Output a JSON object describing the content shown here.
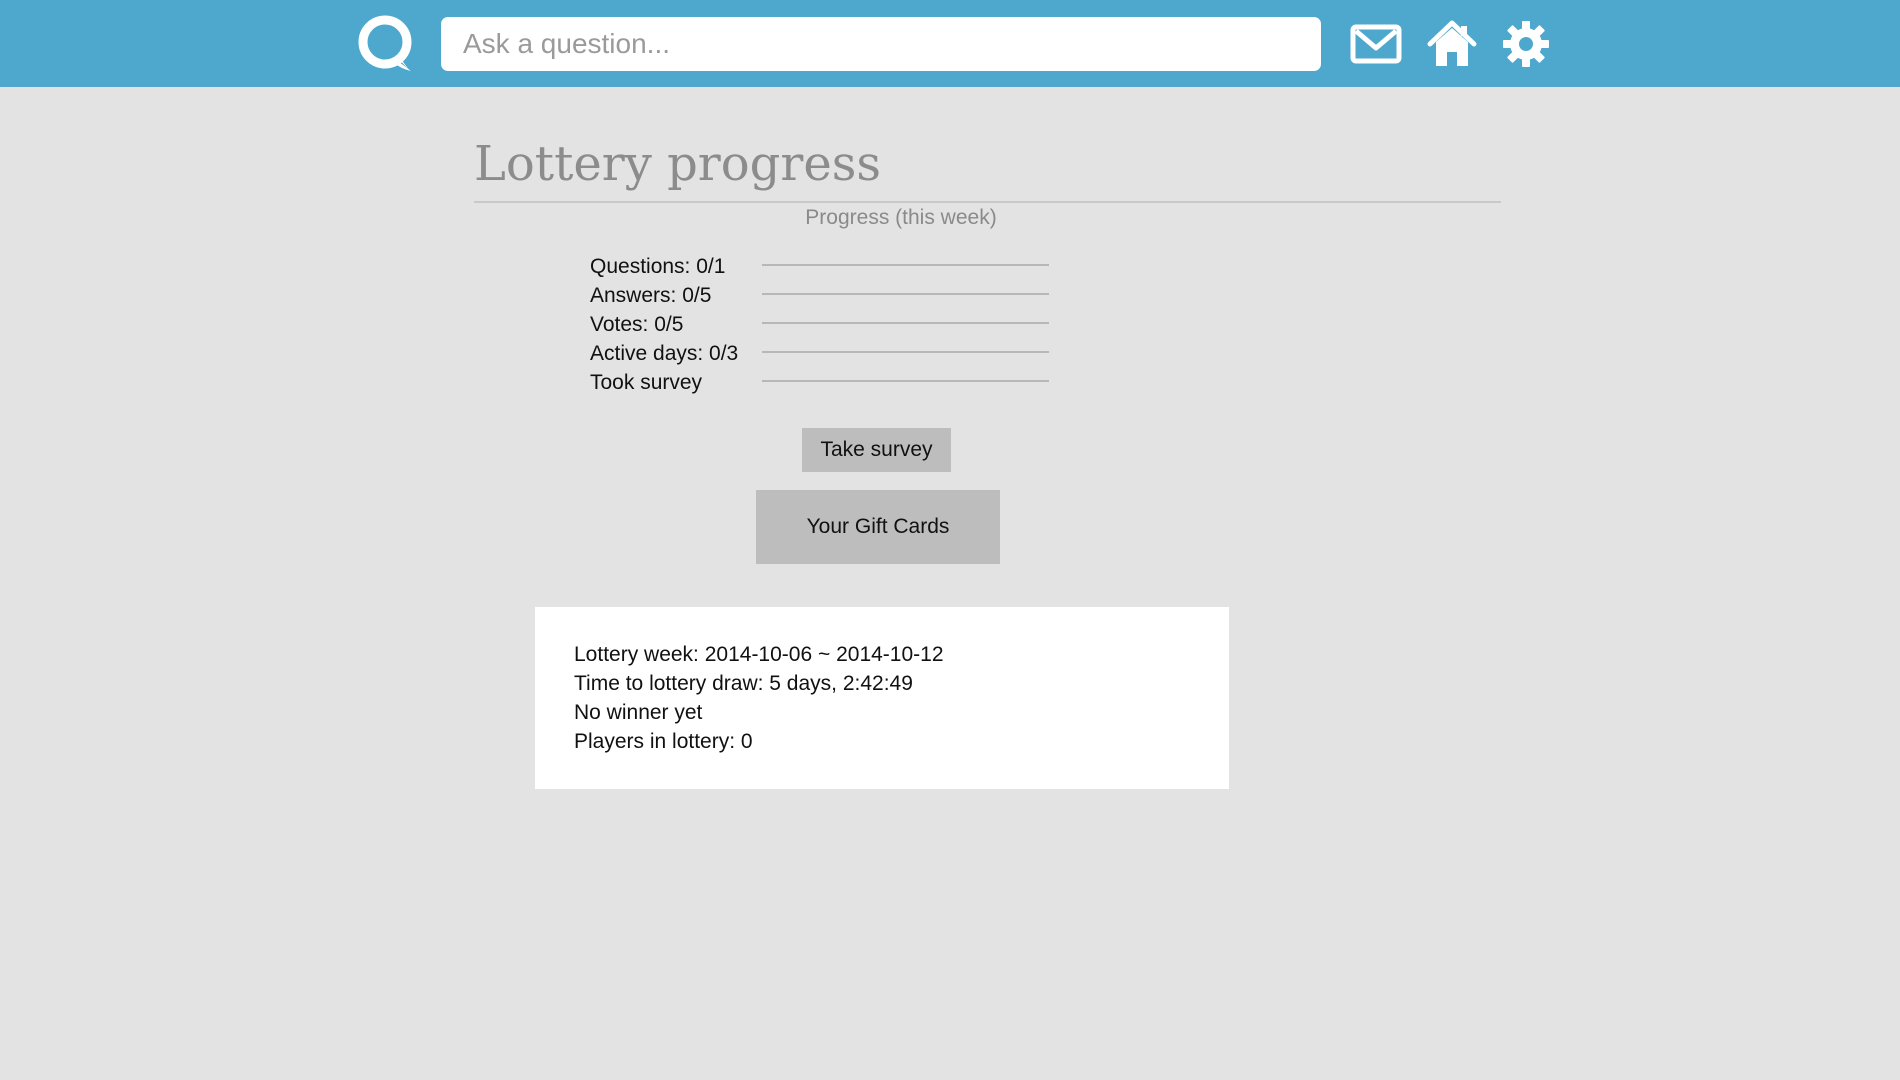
{
  "header": {
    "logo_icon": "speech-bubble-logo-icon",
    "search_placeholder": "Ask a question...",
    "search_value": "",
    "icons": [
      "mail-icon",
      "home-icon",
      "gear-icon"
    ],
    "colors": {
      "bar": "#4ea8cd",
      "background": "#e3e3e3"
    }
  },
  "page": {
    "title": "Lottery progress",
    "progress_caption": "Progress (this week)"
  },
  "progress": [
    {
      "label": "Questions: 0/1",
      "fraction": 0
    },
    {
      "label": "Answers: 0/5",
      "fraction": 0
    },
    {
      "label": "Votes: 0/5",
      "fraction": 0
    },
    {
      "label": "Active days: 0/3",
      "fraction": 0
    },
    {
      "label": "Took survey",
      "fraction": 0
    }
  ],
  "actions": {
    "take_survey": "Take survey",
    "gift_cards": "Your Gift Cards"
  },
  "lottery": {
    "week": "Lottery week: 2014-10-06 ~ 2014-10-12",
    "time_to_draw": "Time to lottery draw: 5 days, 2:42:49",
    "winner": "No winner yet",
    "players": "Players in lottery: 0"
  }
}
